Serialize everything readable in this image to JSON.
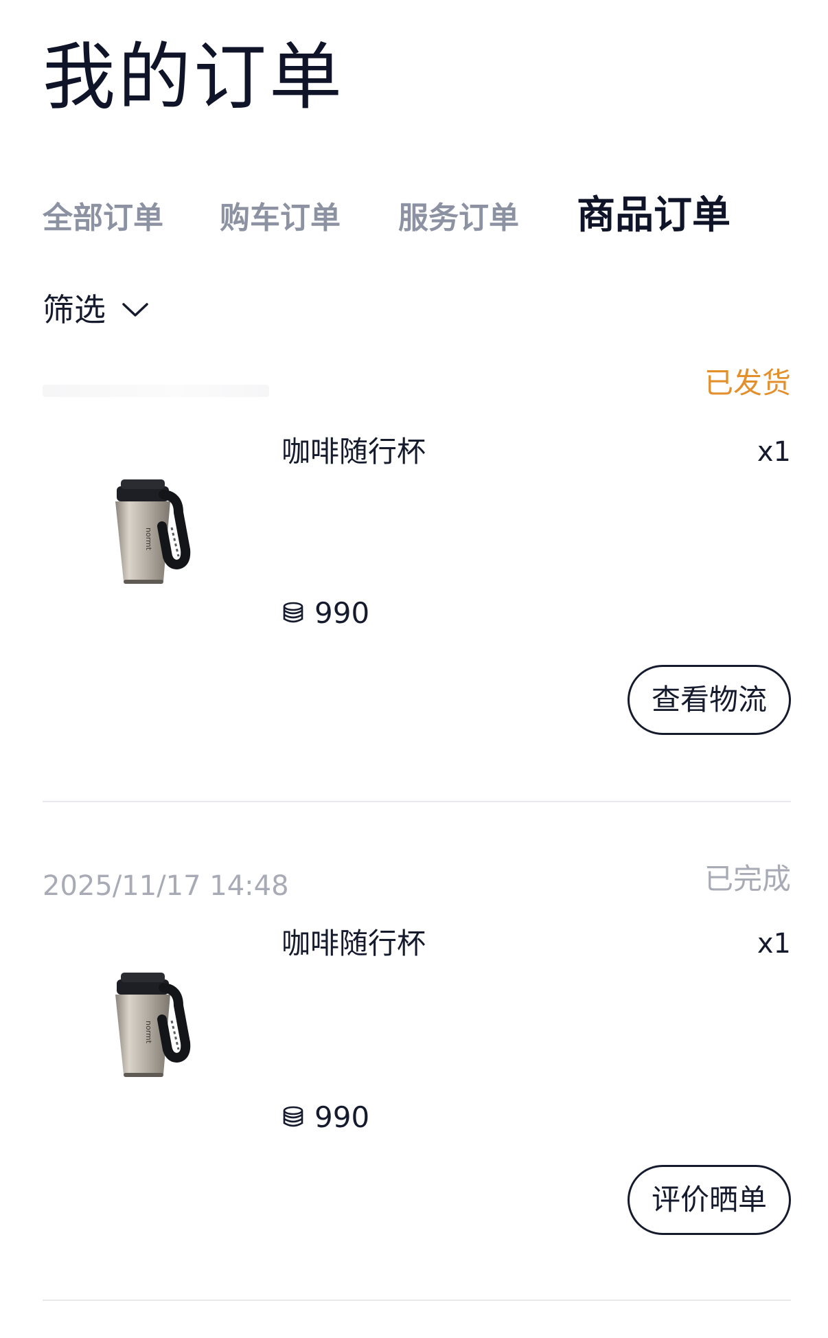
{
  "header": {
    "title": "我的订单"
  },
  "tabs": [
    {
      "label": "全部订单",
      "active": false
    },
    {
      "label": "购车订单",
      "active": false
    },
    {
      "label": "服务订单",
      "active": false
    },
    {
      "label": "商品订单",
      "active": true
    }
  ],
  "filter": {
    "label": "筛选",
    "icon": "chevron-down-icon"
  },
  "orders": [
    {
      "date": "",
      "status": "已发货",
      "status_color": "#e28f2c",
      "product_name": "咖啡随行杯",
      "quantity": "x1",
      "price": "990",
      "price_icon": "coin-stack-icon",
      "action_label": "查看物流"
    },
    {
      "date": "2025/11/17 14:48",
      "status": "已完成",
      "status_color": "#a8abb5",
      "product_name": "咖啡随行杯",
      "quantity": "x1",
      "price": "990",
      "price_icon": "coin-stack-icon",
      "action_label": "评价晒单"
    }
  ],
  "colors": {
    "title": "#0f1429",
    "tab_inactive": "#8d92a3",
    "divider": "#e8e9ed"
  }
}
